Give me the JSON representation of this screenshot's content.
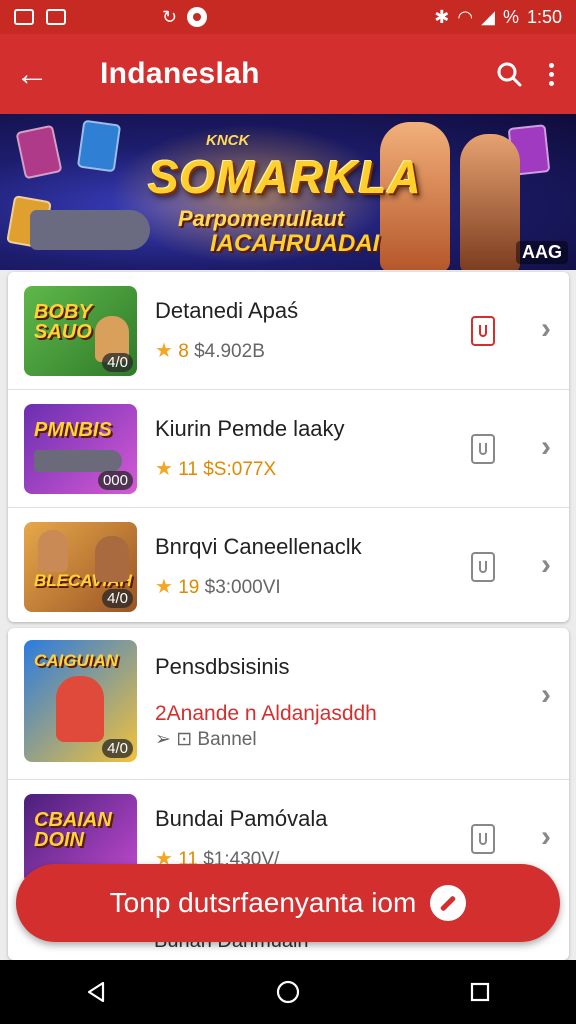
{
  "status_bar": {
    "time": "1:50",
    "battery": "%"
  },
  "app_bar": {
    "title": "Indaneslah"
  },
  "banner": {
    "top_line": "KNCK",
    "headline": "SOMARKLA",
    "sub_line_1": "Parpomenullaut",
    "sub_line_2": "IACAHRUADAI",
    "badge": "AAG"
  },
  "list_group_1": [
    {
      "title": "Detanedi Apaś",
      "rating": "8",
      "meta": "$4.902B",
      "thumb_text": "BOBY\nSAUO",
      "thumb_badge": "4/0",
      "install_active": true
    },
    {
      "title": "Kiurin Pemde  laaky",
      "rating": "11",
      "meta": "$S:077X",
      "thumb_text": "PMNBIS",
      "thumb_badge": "000",
      "install_active": false
    },
    {
      "title": "Bnrqvi Caneellenaclk",
      "rating": "19",
      "meta": "$3:000VI",
      "thumb_text": "BLECAVIAH",
      "thumb_badge": "4/0",
      "install_active": false
    }
  ],
  "list_group_2": [
    {
      "title": "Pensdbsisinis",
      "subtitle": "2Anande n Aldanjasddh",
      "secondary": "Bannel",
      "thumb_text": "CAIGUIAN",
      "thumb_badge": "4/0"
    },
    {
      "title": "Bundai Pamóvala",
      "rating": "11",
      "meta": "$1:430V/",
      "thumb_text": "CBAIAN\nDOIN",
      "thumb_badge": ""
    }
  ],
  "peek_row_title": "Bunan Danmuain",
  "fab": {
    "label": "Tonp dutsrfaenyanta iom"
  }
}
